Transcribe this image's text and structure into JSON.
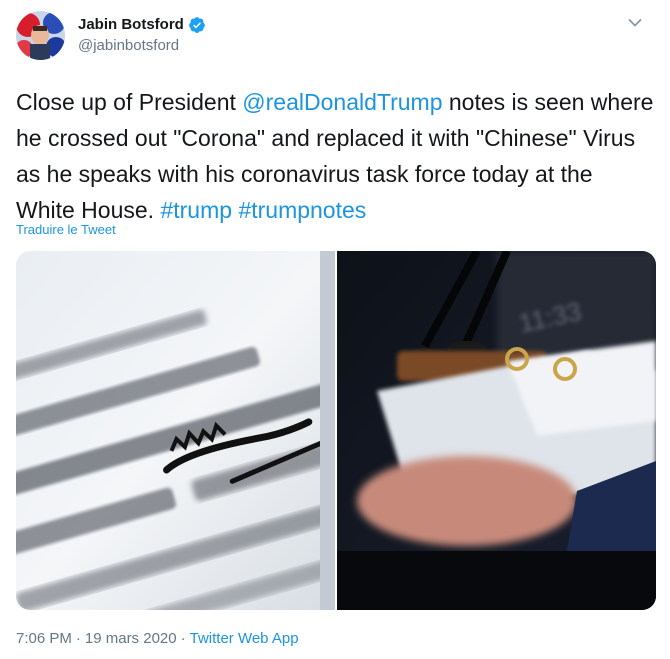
{
  "author": {
    "display_name": "Jabin Botsford",
    "handle": "@jabinbotsford",
    "verified": true,
    "avatar_icon": "profile-photo"
  },
  "tweet": {
    "text_segments": [
      {
        "type": "text",
        "value": "Close up of President "
      },
      {
        "type": "link",
        "value": "@realDonaldTrump"
      },
      {
        "type": "text",
        "value": " notes is seen where he crossed out \"Corona\" and replaced it with \"Chinese\" Virus as he speaks with his coronavirus task force today at the White House. "
      },
      {
        "type": "link",
        "value": "#trump"
      },
      {
        "type": "text",
        "value": " "
      },
      {
        "type": "link",
        "value": "#trumpnotes"
      }
    ],
    "translate_label": "Traduire le Tweet"
  },
  "meta": {
    "time": "7:06 PM",
    "separator": "·",
    "date": "19 mars 2020",
    "separator2": "·",
    "source": "Twitter Web App"
  },
  "colors": {
    "link": "#1b95e0",
    "secondary_text": "#657786",
    "primary_text": "#14171a",
    "verified_badge": "#1da1f2"
  },
  "icons": {
    "verified": "verified-badge-icon",
    "caret": "chevron-down-icon"
  }
}
